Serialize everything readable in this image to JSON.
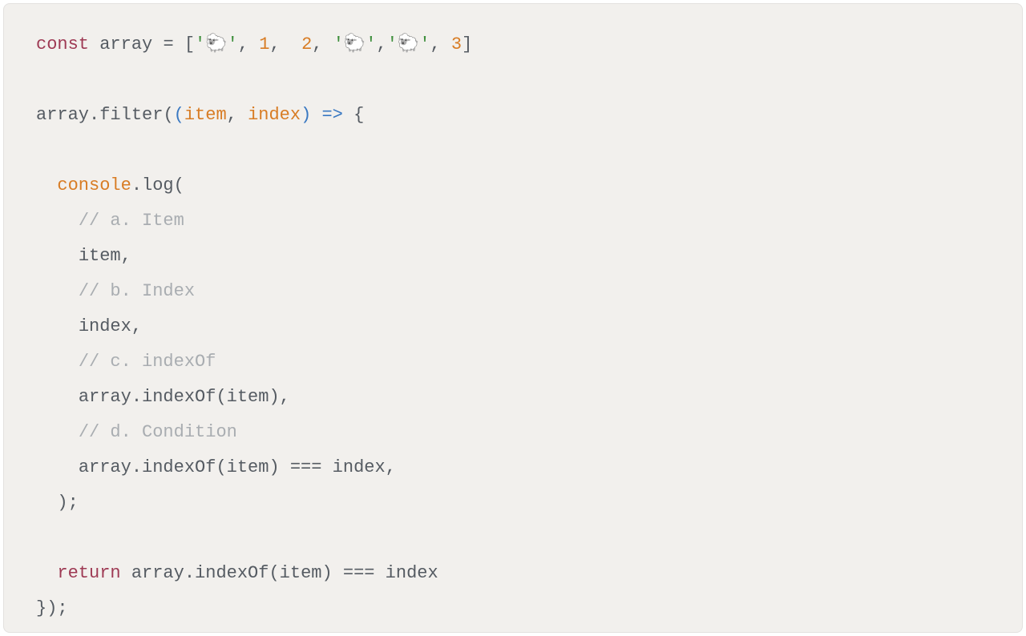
{
  "code": {
    "l1": {
      "kw_const": "const",
      "sp1": " ",
      "arrName": "array",
      "sp2": " ",
      "eq": "=",
      "sp3": " ",
      "lb": "[",
      "q1a": "'",
      "sheep1": "🐑",
      "q1b": "'",
      "c1": ",",
      "sp4": " ",
      "n1": "1",
      "c2": ",",
      "sp5": "  ",
      "n2": "2",
      "c3": ",",
      "sp6": " ",
      "q2a": "'",
      "sheep2": "🐑",
      "q2b": "'",
      "c4": ",",
      "q3a": "'",
      "sheep3": "🐑",
      "q3b": "'",
      "c5": ",",
      "sp7": " ",
      "n3": "3",
      "rb": "]"
    },
    "l2": "",
    "l3": {
      "arr": "array",
      "dot": ".",
      "filter": "filter",
      "p1": "(",
      "p2": "(",
      "item": "item",
      "c": ",",
      "sp": " ",
      "index": "index",
      "p3": ")",
      "sp2": " ",
      "arrow": "=>",
      "sp3": " ",
      "brace": "{"
    },
    "l4": "",
    "l5": {
      "indent": "  ",
      "console": "console",
      "dot": ".",
      "log": "log",
      "p": "("
    },
    "l6": {
      "indent": "    ",
      "comment": "// a. Item"
    },
    "l7": {
      "indent": "    ",
      "item": "item",
      "c": ","
    },
    "l8": {
      "indent": "    ",
      "comment": "// b. Index"
    },
    "l9": {
      "indent": "    ",
      "index": "index",
      "c": ","
    },
    "l10": {
      "indent": "    ",
      "comment": "// c. indexOf"
    },
    "l11": {
      "indent": "    ",
      "call": "array.indexOf(item)",
      "c": ","
    },
    "l12": {
      "indent": "    ",
      "comment": "// d. Condition"
    },
    "l13": {
      "indent": "    ",
      "expr": "array.indexOf(item) === index",
      "c": ","
    },
    "l14": {
      "indent": "  ",
      "close": ");"
    },
    "l15": "",
    "l16": {
      "indent": "  ",
      "ret": "return",
      "sp": " ",
      "expr": "array.indexOf(item) === index"
    },
    "l17": {
      "close": "});"
    }
  }
}
